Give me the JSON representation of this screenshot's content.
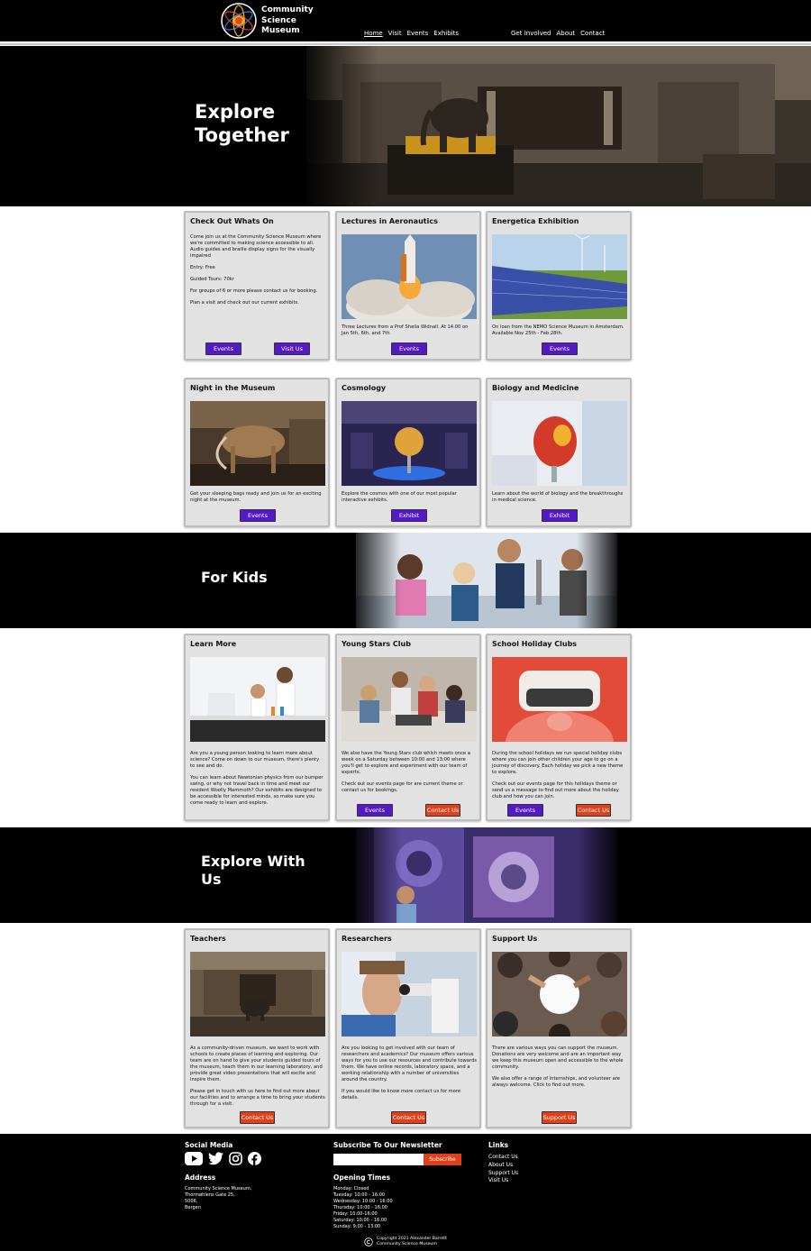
{
  "header": {
    "logo_line1": "Community",
    "logo_line2": "Science",
    "logo_line3": "Museum",
    "nav_left": [
      "Home",
      "Visit",
      "Events",
      "Exhibits"
    ],
    "nav_right": [
      "Get Involved",
      "About",
      "Contact"
    ]
  },
  "hero": {
    "title_line1": "Explore",
    "title_line2": "Together"
  },
  "row1": [
    {
      "title": "Check Out Whats On",
      "paragraphs": [
        "Come join us at the Community Science Museum where we're committed to making science accessible to all. Audio guides and braille display signs for the visually impaired",
        "Entry: Free",
        "Guided Tours: 70kr",
        "For groups of 6 or more please contact us for booking.",
        "Plan a visit and check out our current exhibits."
      ],
      "buttons": [
        "Events",
        "Visit Us"
      ]
    },
    {
      "title": "Lectures in Aeronautics",
      "paragraphs": [
        "Three Lectures from a Prof Sheila Widnall. At 14.00 on Jan 5th, 6th, and 7th"
      ],
      "buttons": [
        "Events"
      ]
    },
    {
      "title": "Energetica Exhibition",
      "paragraphs": [
        "On loan from the NEMO Science Museum in Amsterdam. Available Nov 25th - Feb 28th."
      ],
      "buttons": [
        "Events"
      ]
    }
  ],
  "row2": [
    {
      "title": "Night in the Museum",
      "paragraphs": [
        "Get your sleeping bags ready and join us for an exciting night at the museum."
      ],
      "buttons": [
        "Events"
      ]
    },
    {
      "title": "Cosmology",
      "paragraphs": [
        "Explore the cosmos with one of our most popular interactive exhibits."
      ],
      "buttons": [
        "Exhibit"
      ]
    },
    {
      "title": "Biology and Medicine",
      "paragraphs": [
        "Learn about the world of biology and the breakthroughs in medical science."
      ],
      "buttons": [
        "Exhibit"
      ]
    }
  ],
  "kids_banner": {
    "title": "For Kids"
  },
  "row3": [
    {
      "title": "Learn More",
      "paragraphs": [
        "Are you a young person looking to learn more about science? Come on down to our museum, there's plenty to see and do.",
        "You can learn about Newtonian physics from our bumper swing, or why not travel back in time and meet our resident Woolly Mammoth? Our exhibits are designed to be accessible for interested minds, so make sure you come ready to learn and explore."
      ],
      "buttons": []
    },
    {
      "title": "Young Stars Club",
      "paragraphs": [
        "We also have the Young Stars club which meets once a week on a Saturday between 10:00 and 13:00 where you'll get to explore and experiment with our team of experts.",
        "Check out our events page for are current theme or contact us for bookings."
      ],
      "buttons": [
        "Events",
        "Contact Us"
      ]
    },
    {
      "title": "School Holiday Clubs",
      "paragraphs": [
        "During the school holidays we run special holiday clubs where you can join other children your age to go on a journey of discovery. Each holiday we pick a new theme to explore.",
        "Check out our events page for this holidays theme or send us a message to find out more about the holiday club and how you can join."
      ],
      "buttons": [
        "Events",
        "Contact Us"
      ]
    }
  ],
  "explore_banner": {
    "title_line1": "Explore With",
    "title_line2": "Us"
  },
  "row4": [
    {
      "title": "Teachers",
      "paragraphs": [
        "As a community-driven museum, we want to work with schools to create places of learning and exploring. Our team are on hand to give your students guided tours of the museum, teach them in our learning laboratory, and provide great video presentations that will excite and inspire them.",
        "Please get in touch with us here to find out more about our facilities and to arrange a time to bring your students through for a visit."
      ],
      "buttons": [
        "Contact Us"
      ]
    },
    {
      "title": "Researchers",
      "paragraphs": [
        "Are you looking to get involved with our team of researchers and academics? Our museum offers various ways for you to use our resources and contribute towards them. We have online records, laboratory space, and a working relationship with a number of universities around the country.",
        "If you would like to know more contact us for more details."
      ],
      "buttons": [
        "Contact Us"
      ]
    },
    {
      "title": "Support Us",
      "paragraphs": [
        "There are various ways you can support the museum. Donations are very welcome and are an important way we keep this museum open and accessible to the whole community.",
        "We also offer a range of internships, and volunteer are always welcome. Click to find out more."
      ],
      "buttons": [
        "Support Us"
      ]
    }
  ],
  "footer": {
    "social_title": "Social Media",
    "address_title": "Address",
    "address_lines": [
      "Community Science Museum,",
      "Thormøhlens Gate 25,",
      "5006,",
      "Bergen"
    ],
    "newsletter_title": "Subscribe To Our Newsletter",
    "subscribe_label": "Subscribe",
    "hours_title": "Opening Times",
    "hours": [
      "Monday: Closed",
      "Tuesday: 10:00 - 16:00",
      "Wednesday: 10:00 - 16:00",
      "Thursday: 10:00 - 16:00",
      "Friday: 10:00-16:00",
      "Saturday: 10:00 - 16:00",
      "Sunday: 9:00 - 13:00"
    ],
    "links_title": "Links",
    "links": [
      "Contact Us",
      "About Us",
      "Support Us",
      "Visit Us"
    ],
    "copyright_line1": "Copyright 2021 Alexander Barrett",
    "copyright_line2": "Community Science Museum"
  }
}
